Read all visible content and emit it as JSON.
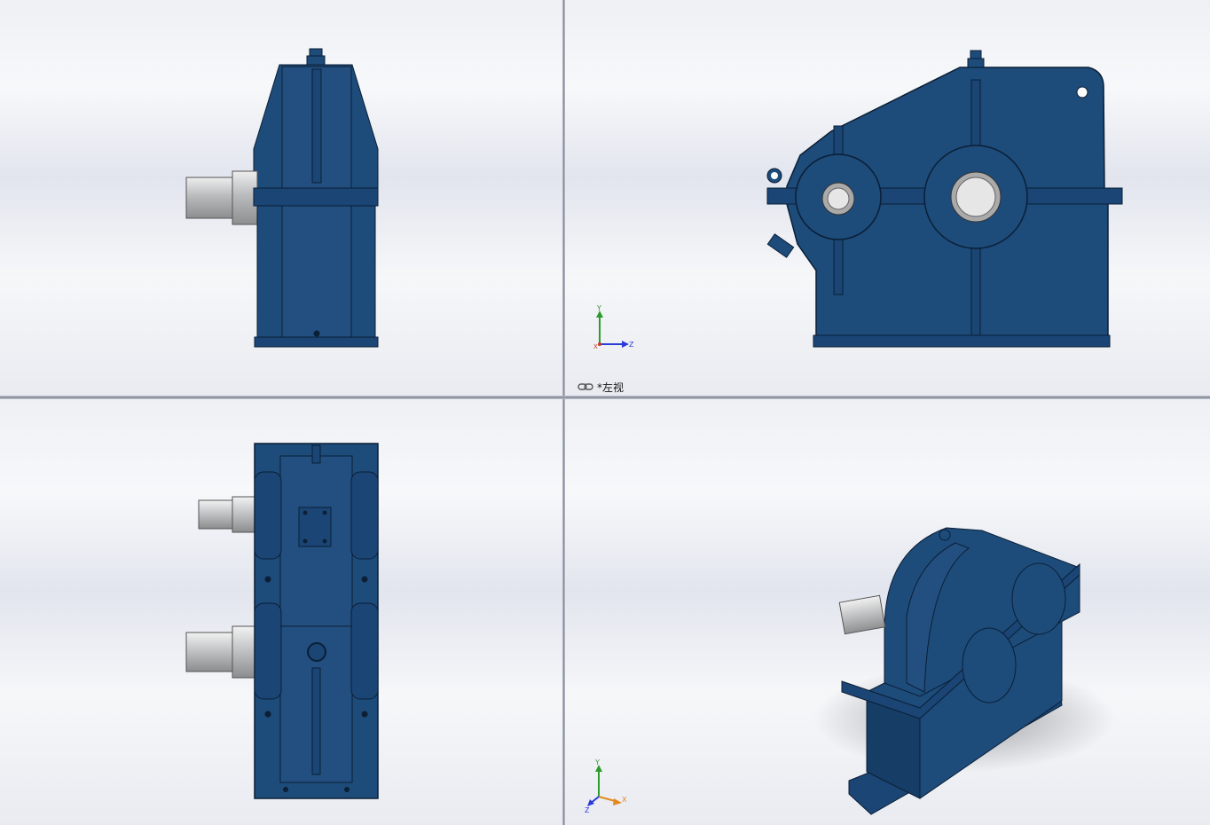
{
  "viewports": {
    "top_left": {
      "name": "front-view"
    },
    "top_right": {
      "name": "left-view",
      "label": "*左视"
    },
    "bottom_left": {
      "name": "top-view"
    },
    "bottom_right": {
      "name": "isometric-view"
    }
  },
  "triads": {
    "top_right": {
      "axes": [
        "Y",
        "X",
        "Z"
      ]
    },
    "bottom_right": {
      "axes": [
        "Y",
        "Z",
        "X"
      ]
    }
  },
  "icons": [
    "view-link-icon",
    "axis-triad-icon"
  ],
  "colors": {
    "housing_blue": "#1d4b7a",
    "housing_dark": "#123459",
    "shaft_gray": "#c8cacc",
    "axis_y": "#2e9b2e",
    "axis_z": "#2b3bd6",
    "axis_x": "#c0392b",
    "axis_x_iso": "#e08a1e"
  }
}
